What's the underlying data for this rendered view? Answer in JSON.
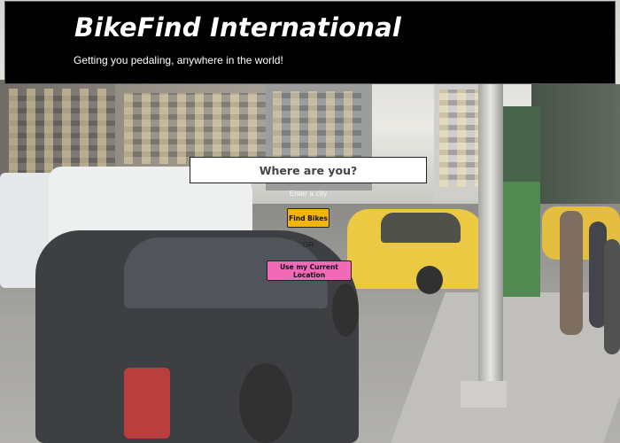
{
  "header": {
    "title": "BikeFind International",
    "tagline": "Getting you pedaling, anywhere in the world!"
  },
  "search": {
    "heading": "Where are you?",
    "city_placeholder": "Enter a city",
    "find_label": "Find Bikes",
    "or_label": "OR",
    "location_label": "Use my Current Location"
  },
  "colors": {
    "header_bg": "#000000",
    "find_button": "#f3b40b",
    "location_button": "#f06ab8"
  }
}
